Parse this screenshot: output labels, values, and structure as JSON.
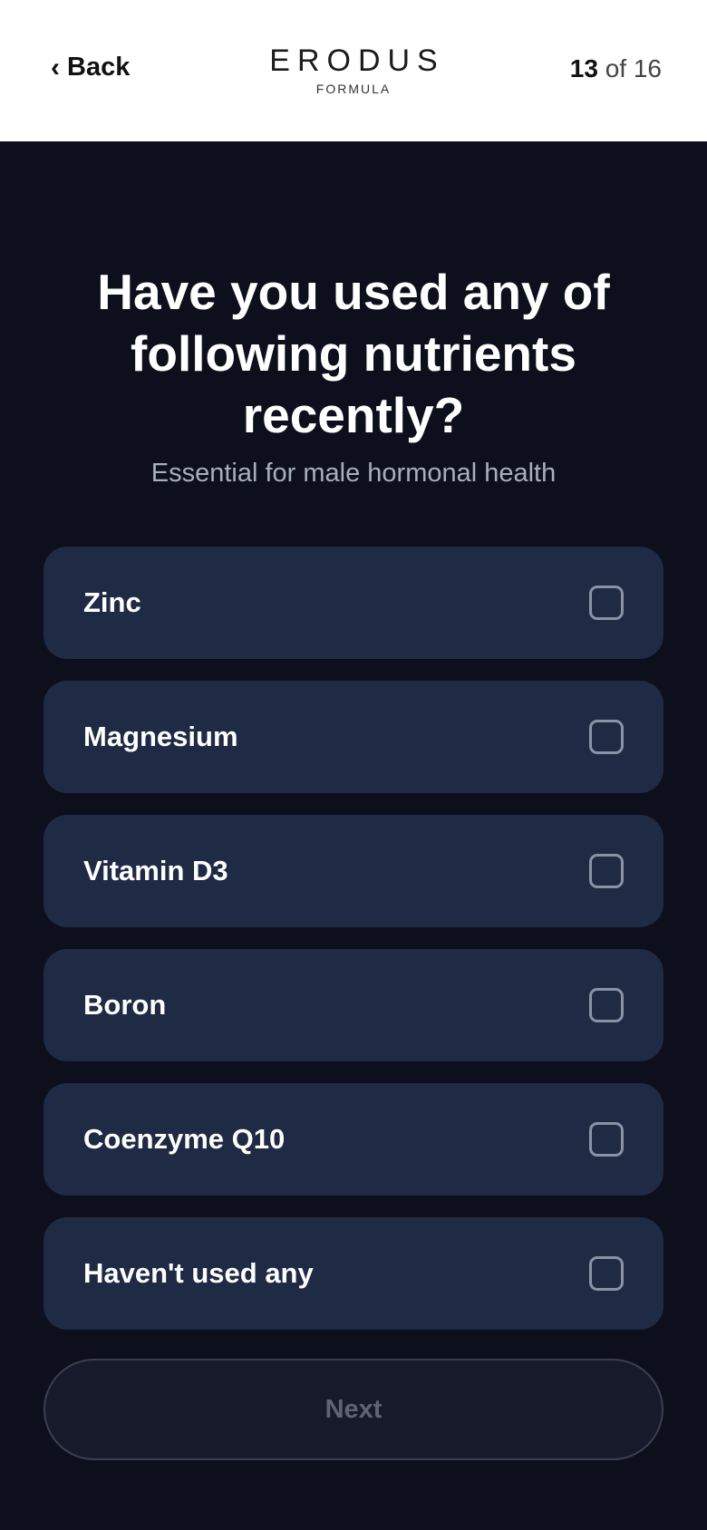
{
  "header": {
    "back_label": "Back",
    "back_icon": "chevron-left-icon",
    "brand": "ERODUS",
    "brand_sub": "FORMULA",
    "progress_current": "13",
    "progress_sep": "of",
    "progress_total": "16"
  },
  "question": {
    "title": "Have you used any of following nutrients recently?",
    "subtitle": "Essential for male hormonal health"
  },
  "options": [
    {
      "label": "Zinc",
      "checked": false
    },
    {
      "label": "Magnesium",
      "checked": false
    },
    {
      "label": "Vitamin D3",
      "checked": false
    },
    {
      "label": "Boron",
      "checked": false
    },
    {
      "label": "Coenzyme Q10",
      "checked": false
    },
    {
      "label": "Haven't used any",
      "checked": false
    }
  ],
  "footer": {
    "next_label": "Next",
    "next_enabled": false
  },
  "colors": {
    "background": "#0d0f1c",
    "option_bg": "#1f2a44",
    "header_bg": "#ffffff",
    "subtitle": "#a8afbf",
    "next_disabled_text": "#5e6473"
  }
}
